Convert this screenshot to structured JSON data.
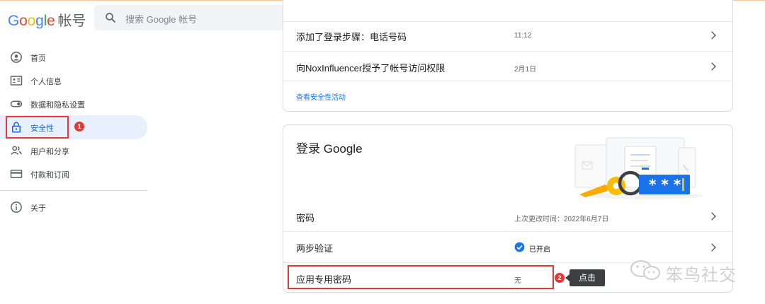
{
  "header": {
    "logo_letters": [
      "G",
      "o",
      "o",
      "g",
      "l",
      "e"
    ],
    "product": "帐号",
    "search_placeholder": "搜索 Google 帐号"
  },
  "sidebar": {
    "items": [
      {
        "label": "首页",
        "icon": "home-icon"
      },
      {
        "label": "个人信息",
        "icon": "id-card-icon"
      },
      {
        "label": "数据和隐私设置",
        "icon": "toggle-icon"
      },
      {
        "label": "安全性",
        "icon": "lock-icon",
        "active": true
      },
      {
        "label": "用户和分享",
        "icon": "people-icon"
      },
      {
        "label": "付款和订阅",
        "icon": "credit-card-icon"
      },
      {
        "label": "关于",
        "icon": "info-icon"
      }
    ]
  },
  "security_activity": {
    "rows": [
      {
        "label": "添加了登录步骤：电话号码",
        "value": "11:12"
      },
      {
        "label": "向NoxInfluencer授予了帐号访问权限",
        "value": "2月1日"
      }
    ],
    "link": "查看安全性活动"
  },
  "signin_card": {
    "title": "登录 Google",
    "illustration_password": "* * *",
    "rows": [
      {
        "label": "密码",
        "value": "上次更改时间：2022年6月7日"
      },
      {
        "label": "两步验证",
        "value": "已开启",
        "status": "check-circle-icon"
      },
      {
        "label": "应用专用密码",
        "value": "无"
      }
    ]
  },
  "annotations": {
    "badge1": "1",
    "badge2": "2",
    "tooltip": "点击"
  },
  "watermark": {
    "text": "笨鸟社交"
  },
  "colors": {
    "accent_blue": "#1a73e8",
    "active_bg": "#e8f0fe",
    "annotation_red": "#e53935"
  }
}
